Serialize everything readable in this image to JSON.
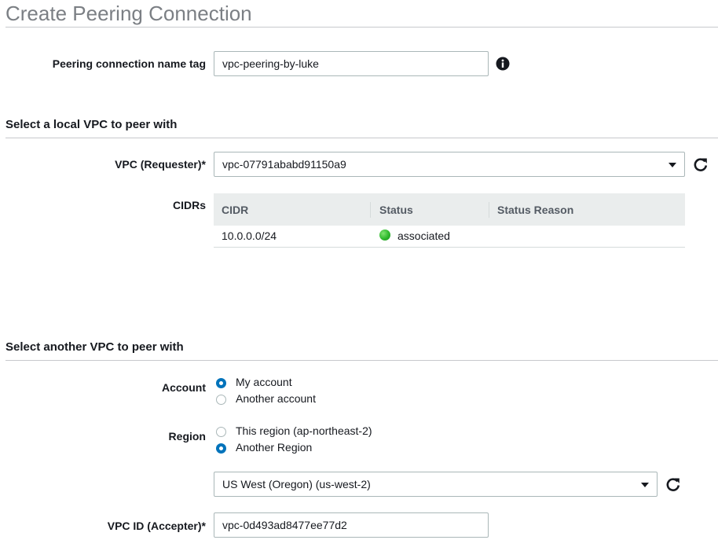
{
  "page": {
    "title": "Create Peering Connection"
  },
  "name_tag": {
    "label": "Peering connection name tag",
    "value": "vpc-peering-by-luke"
  },
  "local": {
    "section_title": "Select a local VPC to peer with",
    "vpc_label": "VPC (Requester)*",
    "vpc_value": "vpc-07791ababd91150a9",
    "cidrs_label": "CIDRs",
    "table": {
      "columns": [
        "CIDR",
        "Status",
        "Status Reason"
      ],
      "rows": [
        {
          "cidr": "10.0.0.0/24",
          "status": "associated",
          "status_reason": ""
        }
      ],
      "status_color": "#2db82d"
    }
  },
  "remote": {
    "section_title": "Select another VPC to peer with",
    "account_label": "Account",
    "account_options": [
      "My account",
      "Another account"
    ],
    "account_selected": "My account",
    "region_label": "Region",
    "region_options": [
      "This region (ap-northeast-2)",
      "Another Region"
    ],
    "region_selected": "Another Region",
    "region_select_value": "US West (Oregon) (us-west-2)",
    "vpc_id_label": "VPC ID (Accepter)*",
    "vpc_id_value": "vpc-0d493ad8477ee77d2"
  },
  "colors": {
    "accent": "#0073bb",
    "title_gray": "#7b7f84"
  }
}
